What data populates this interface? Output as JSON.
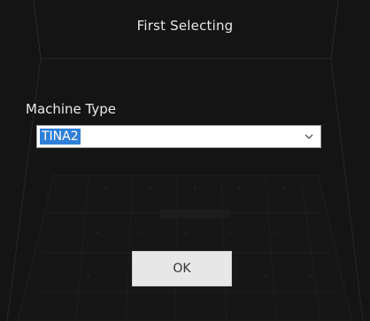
{
  "dialog": {
    "title": "First Selecting",
    "machine_type_label": "Machine Type",
    "machine_type_selected": "TINA2",
    "ok_label": "OK"
  },
  "colors": {
    "background": "#151515",
    "selection_highlight": "#2f7fd7",
    "button_bg": "#e7e7e7"
  },
  "icons": {
    "dropdown": "chevron-down-icon"
  }
}
